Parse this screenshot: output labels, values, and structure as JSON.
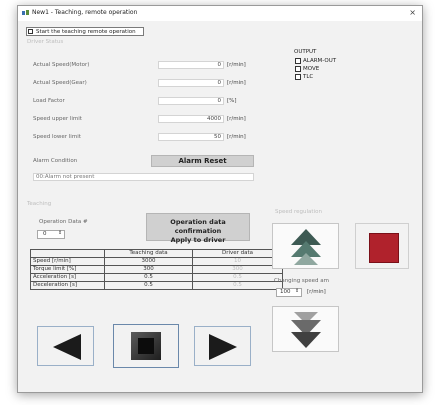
{
  "window": {
    "title": "New1 - Teaching, remote operation",
    "close": "×",
    "brand_icon_color": "#3a6fb0"
  },
  "start_checkbox": {
    "label": "Start the teaching remote operation",
    "checked": false
  },
  "driver_status": {
    "section_label": "Driver Status",
    "rows": [
      {
        "label": "Actual Speed(Motor)",
        "value": "0",
        "unit": "[r/min]"
      },
      {
        "label": "Actual Speed(Gear)",
        "value": "0",
        "unit": "[r/min]"
      },
      {
        "label": "Load Factor",
        "value": "0",
        "unit": "[%]"
      },
      {
        "label": "Speed upper limit",
        "value": "4000",
        "unit": "[r/min]"
      },
      {
        "label": "Speed lower limit",
        "value": "50",
        "unit": "[r/min]"
      }
    ],
    "alarm_label": "Alarm Condition",
    "alarm_reset_button": "Alarm Reset",
    "alarm_message": "00:Alarm not present"
  },
  "output": {
    "label": "OUTPUT",
    "items": [
      "ALARM-OUT",
      "MOVE",
      "TLC"
    ]
  },
  "teaching": {
    "section_label": "Teaching",
    "operation_data_label": "Operation Data #",
    "operation_data_value": "0",
    "confirm_button_line1": "Operation data confirmation",
    "confirm_button_line2": "Apply to driver",
    "table": {
      "headers": [
        "",
        "Teaching data",
        "Driver data"
      ],
      "rows": [
        {
          "label": "Speed [r/min]",
          "teaching": "3000",
          "driver": "10"
        },
        {
          "label": "Torque limit [%]",
          "teaching": "300",
          "driver": "300"
        },
        {
          "label": "Acceleration [s]",
          "teaching": "0.5",
          "driver": "0.5"
        },
        {
          "label": "Deceleration [s]",
          "teaching": "0.5",
          "driver": "0.5"
        }
      ]
    }
  },
  "speed_regulation": {
    "label": "Speed regulation",
    "changing_speed_label": "Changing speed am",
    "changing_speed_value": "100",
    "changing_speed_unit": "[r/min]"
  },
  "colors": {
    "stop_red": "#b0222c",
    "arrow_dark": "#1b1b1b",
    "up_arrow_dark": "#3d5a53",
    "down_arrow_dark": "#404040"
  }
}
